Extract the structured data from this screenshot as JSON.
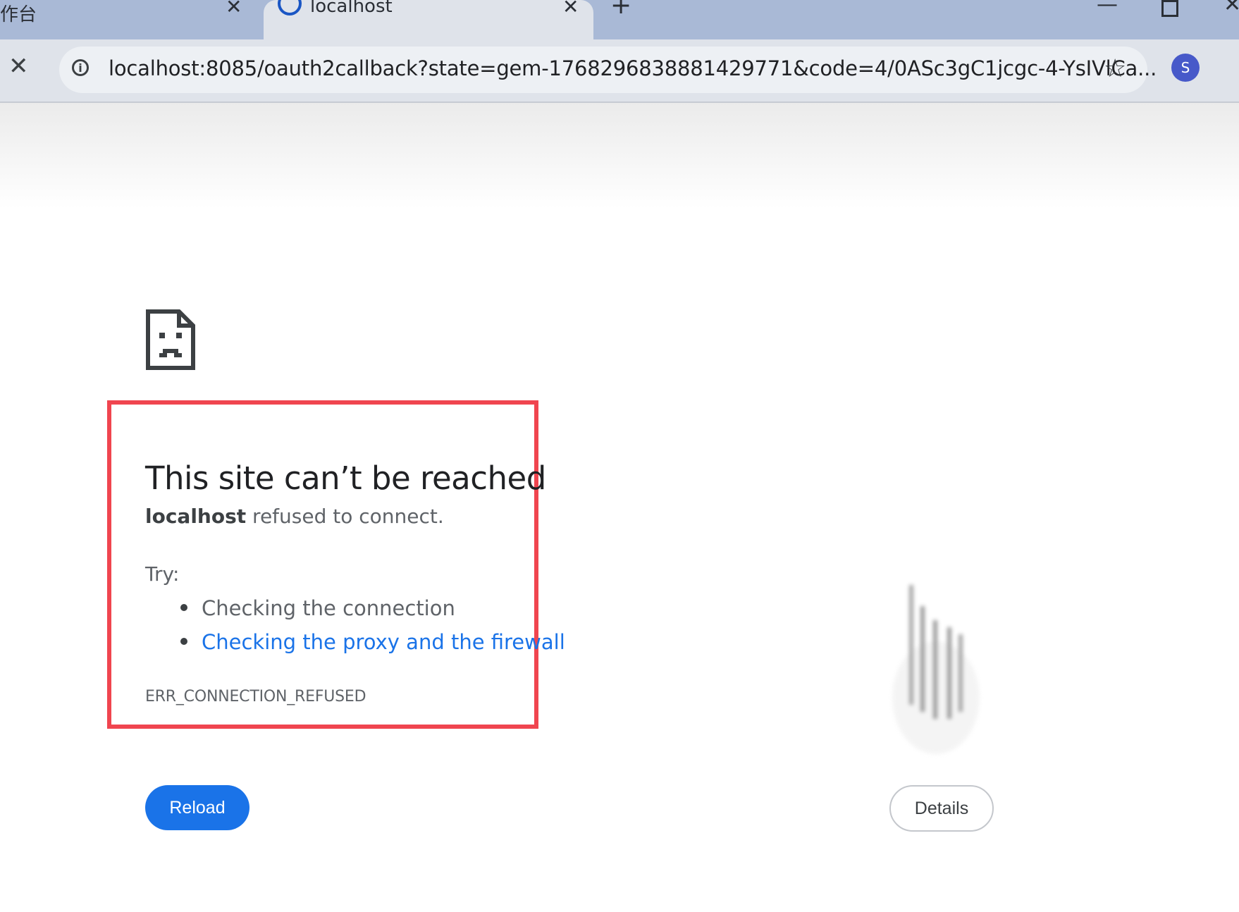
{
  "tabs": [
    {
      "title": "作台",
      "close": "✕",
      "active": false
    },
    {
      "title": "localhost",
      "close": "✕",
      "active": true,
      "loading": true
    }
  ],
  "tabstrip": {
    "new_tab": "+",
    "minimize": "—",
    "close_window": "✕"
  },
  "toolbar": {
    "stop": "✕",
    "url": "localhost:8085/oauth2callback?state=gem-1768296838881429771&code=4/0ASc3gC1jcgc-4-YsIVlCa...",
    "bookmark": "☆",
    "avatar_initial": "S",
    "menu": "⋮"
  },
  "error_page": {
    "heading": "This site can’t be reached",
    "host": "localhost",
    "message": " refused to connect.",
    "try_label": "Try:",
    "suggestions": [
      {
        "text": "Checking the connection",
        "link": false
      },
      {
        "text": "Checking the proxy and the firewall",
        "link": true
      }
    ],
    "error_code": "ERR_CONNECTION_REFUSED",
    "reload_label": "Reload",
    "details_label": "Details"
  },
  "colors": {
    "accent": "#1a73e8",
    "highlight_border": "#f0454f",
    "avatar_bg": "#4759c9",
    "tabstrip_bg": "#a9b9d6",
    "toolbar_bg": "#dfe3ea"
  }
}
